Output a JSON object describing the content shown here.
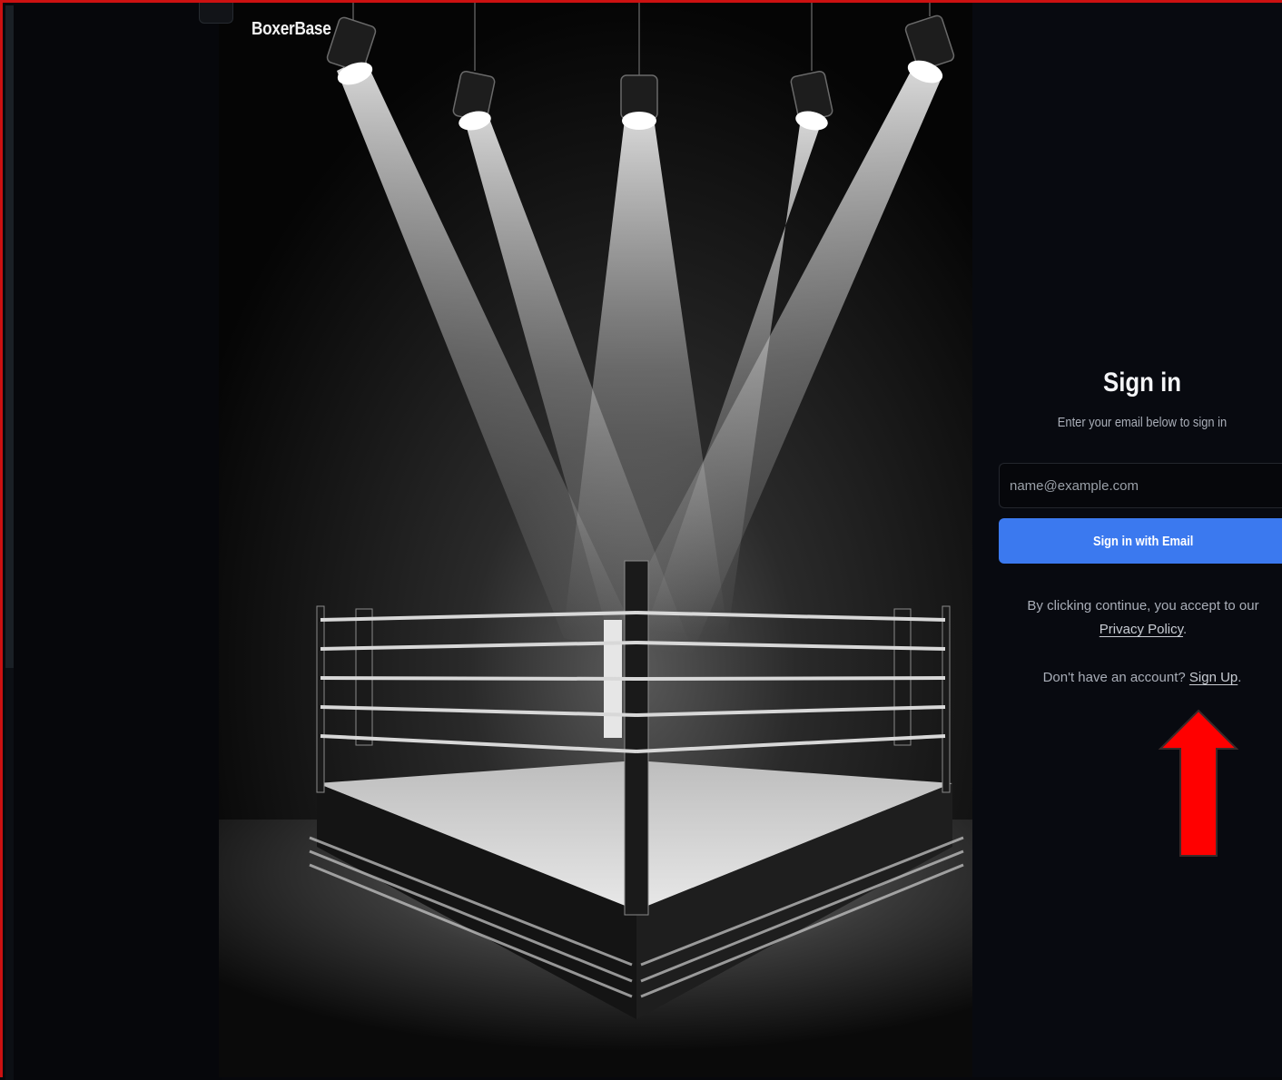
{
  "brand": {
    "name": "BoxerBase"
  },
  "signin": {
    "title": "Sign in",
    "subtitle": "Enter your email below to sign in",
    "email_placeholder": "name@example.com",
    "email_value": "",
    "button_label": "Sign in with Email",
    "legal_prefix": "By clicking continue, you accept to our",
    "privacy_link": "Privacy Policy",
    "legal_suffix": ".",
    "signup_prefix": "Don't have an account?",
    "signup_link": "Sign Up",
    "signup_suffix": "."
  },
  "hero": {
    "image_subject": "boxing-ring-under-spotlights"
  },
  "annotation": {
    "arrow_color": "#ff0000",
    "arrow_direction": "up"
  },
  "colors": {
    "accent": "#3b79ef",
    "page_background": "#080a10",
    "frame_border": "#cc1111"
  }
}
